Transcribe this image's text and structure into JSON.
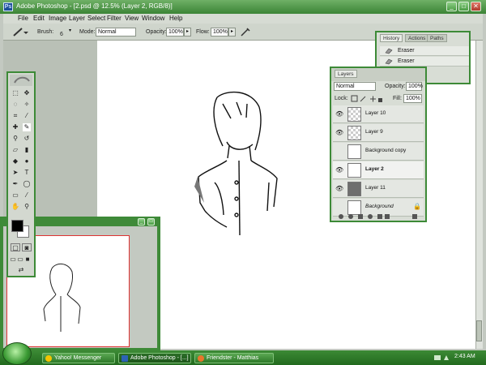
{
  "window": {
    "title": "Adobe Photoshop - [2.psd @ 12.5% (Layer 2, RGB/8)]",
    "app_icon_glyph": "Ps",
    "controls": [
      "_",
      "□",
      "✕"
    ],
    "accent": "#3b8436"
  },
  "menu": [
    "File",
    "Edit",
    "Image",
    "Layer",
    "Select",
    "Filter",
    "View",
    "Window",
    "Help"
  ],
  "options": {
    "brush_label": "Brush:",
    "brush_size": "6",
    "mode_label": "Mode:",
    "mode_value": "Normal",
    "opacity_label": "Opacity:",
    "opacity_value": "100%",
    "flow_label": "Flow:",
    "flow_value": "100%"
  },
  "history": {
    "tabs": [
      "History",
      "Actions",
      "Paths"
    ],
    "items": [
      "Eraser",
      "Eraser"
    ]
  },
  "layers": {
    "title": "Layers",
    "blend": "Normal",
    "opacity_label": "Opacity:",
    "opacity_value": "100%",
    "lock_label": "Lock:",
    "fill_label": "Fill:",
    "fill_value": "100%",
    "rows": [
      {
        "name": "Layer 10"
      },
      {
        "name": "Layer 9"
      },
      {
        "name": "Background copy"
      },
      {
        "name": "Layer 2"
      },
      {
        "name": "Layer 11"
      },
      {
        "name": "Background"
      }
    ]
  },
  "taskbar": {
    "items": [
      "Yahoo! Messenger",
      "Adobe Photoshop - [...]",
      "Friendster - Matthias"
    ],
    "clock": "2:43 AM"
  }
}
